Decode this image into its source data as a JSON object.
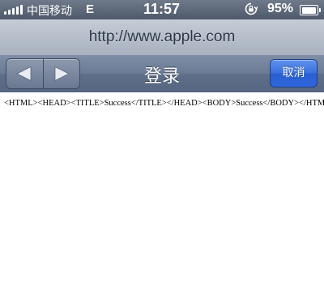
{
  "status_bar": {
    "carrier": "中国移动",
    "network": "E",
    "time": "11:57",
    "battery": "95%",
    "battery_level": 0.95,
    "signal_bars": 5,
    "icons": [
      "signal-icon",
      "rotation-lock-icon",
      "battery-icon"
    ]
  },
  "url_bar": {
    "url": "http://www.apple.com"
  },
  "nav_bar": {
    "title": "登录",
    "cancel_label": "取消",
    "icons": [
      "back-arrow-icon",
      "forward-arrow-icon"
    ]
  },
  "content": {
    "text": "<HTML><HEAD><TITLE>Success</TITLE></HEAD><BODY>Success</BODY></HTML>"
  },
  "colors": {
    "nav_bar": "#6b7b95",
    "cancel_button": "#3a6fdc",
    "url_bar": "#b7bfcc"
  }
}
